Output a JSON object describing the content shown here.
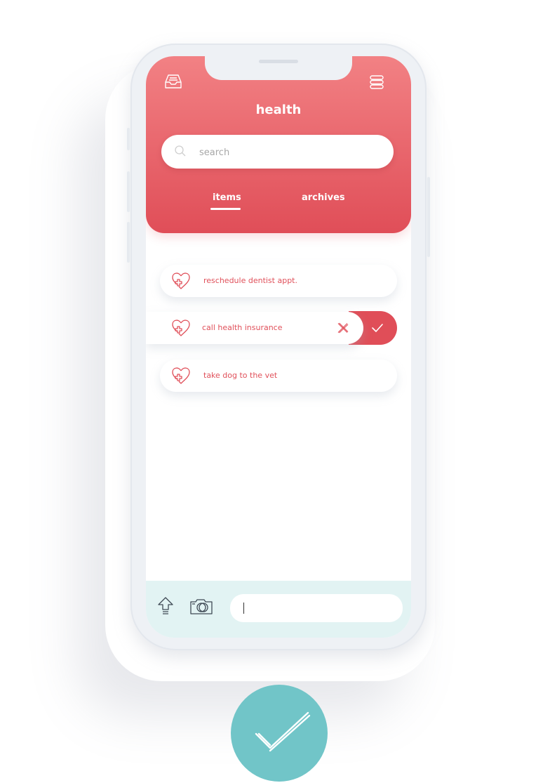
{
  "header": {
    "title": "health",
    "search_placeholder": "search"
  },
  "tabs": [
    {
      "label": "items",
      "active": true
    },
    {
      "label": "archives",
      "active": false
    }
  ],
  "items": [
    {
      "label": "reschedule dentist appt.",
      "icon": "heart-plus-icon"
    },
    {
      "label": "call health insurance",
      "icon": "heart-plus-icon",
      "swiped": true
    },
    {
      "label": "take dog to the vet",
      "icon": "heart-plus-icon"
    }
  ],
  "bottom_bar": {
    "input_value": "",
    "icons": [
      "upload-arrow-icon",
      "camera-icon"
    ]
  },
  "icons": {
    "top_left": "inbox-tray-icon",
    "top_right": "menu-stack-icon",
    "confirm": "checkmark-icon",
    "delete": "close-x-icon"
  },
  "colors": {
    "accent": "#e04e58",
    "header_top": "#f28184",
    "bottom_bar": "#e2f3f3",
    "confirm_badge": "#71c5c8"
  }
}
